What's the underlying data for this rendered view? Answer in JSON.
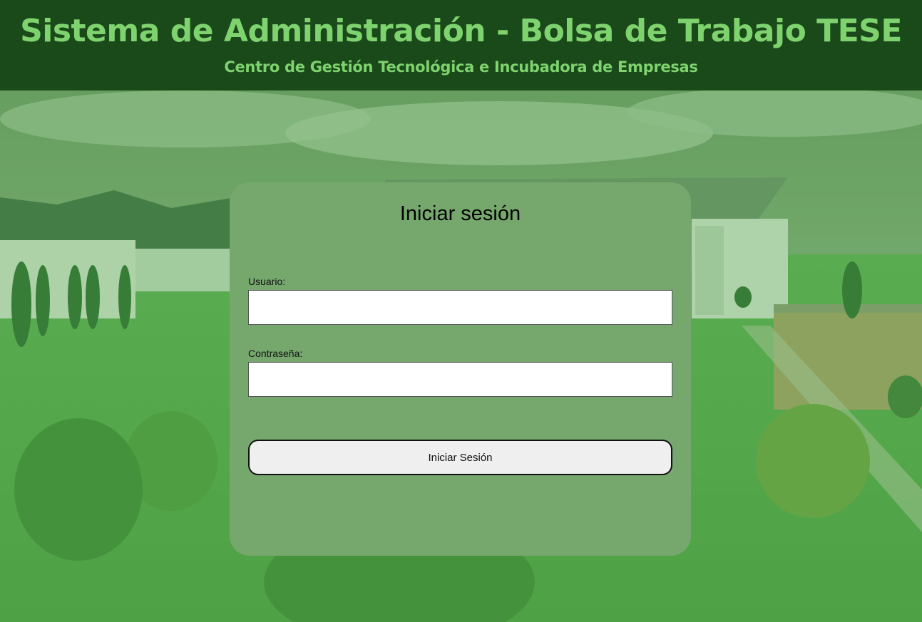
{
  "header": {
    "title": "Sistema de Administración - Bolsa de Trabajo TESE",
    "subtitle": "Centro de Gestión Tecnológica e Incubadora de Empresas"
  },
  "login": {
    "title": "Iniciar sesión",
    "username_label": "Usuario:",
    "username_value": "",
    "password_label": "Contraseña:",
    "password_value": "",
    "submit_label": "Iniciar Sesión"
  },
  "colors": {
    "header_bg": "#1a4a1a",
    "header_text": "#7fd36f",
    "card_bg": "#76a86e",
    "button_bg": "#efefef"
  }
}
